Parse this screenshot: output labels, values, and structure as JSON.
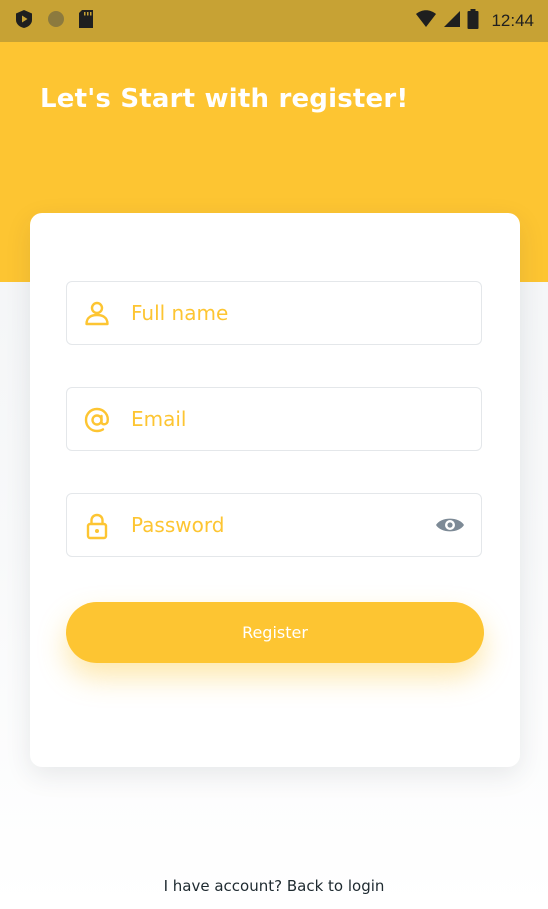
{
  "status_bar": {
    "time": "12:44",
    "icons": [
      "play-shield-icon",
      "circle-icon",
      "sd-card-icon",
      "wifi-icon",
      "signal-icon",
      "battery-icon"
    ]
  },
  "header": {
    "title": "Let's Start with register!"
  },
  "form": {
    "full_name_placeholder": "Full name",
    "email_placeholder": "Email",
    "password_placeholder": "Password",
    "register_label": "Register"
  },
  "footer": {
    "login_link": "I have account? Back to login"
  },
  "colors": {
    "accent": "#fdc532",
    "status_bar": "#c7a234",
    "eye_icon": "#7d8a96"
  }
}
